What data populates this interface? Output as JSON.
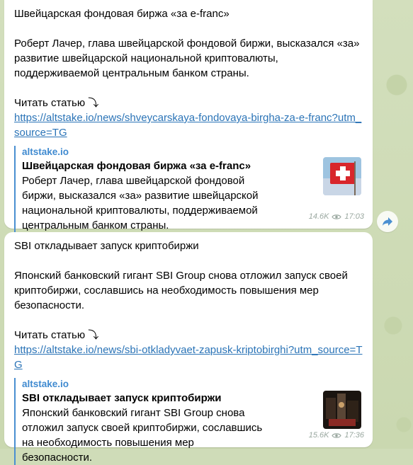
{
  "messages": [
    {
      "title": "Швейцарская фондовая биржа «за e-franc»",
      "body": "Роберт Лачер, глава швейцарской фондовой биржи, высказался «за» развитие швейцарской национальной криптовалюты, поддерживаемой центральным банком страны.",
      "read_label": "Читать статью ⤵",
      "link": "https://altstake.io/news/shveycarskaya-fondovaya-birgha-za-e-franc?utm_source=TG",
      "preview": {
        "site": "altstake.io",
        "title": "Швейцарская фондовая биржа «за e-franc»",
        "body": "Роберт Лачер, глава швейцарской фондовой биржи, высказался «за» развитие швейцарской национальной криптовалюты, поддерживаемой центральным банком страны."
      },
      "views": "14.6K",
      "time": "17:03"
    },
    {
      "title": "SBI откладывает запуск криптобиржи",
      "body": "Японский банковский гигант SBI Group снова отложил запуск своей криптобиржи, сославшись на необходимость повышения мер безопасности.",
      "read_label": "Читать статью ⤵",
      "link": "https://altstake.io/news/sbi-otkladyvaet-zapusk-kriptobirghi?utm_source=TG",
      "preview": {
        "site": "altstake.io",
        "title": "SBI откладывает запуск криптобиржи",
        "body": "Японский банковский гигант SBI Group снова отложил запуск своей криптобиржи, сославшись на необходимость повышения мер безопасности."
      },
      "views": "15.6K",
      "time": "17:36"
    }
  ],
  "icons": {
    "views": "eye-icon",
    "share": "share-arrow-icon"
  },
  "colors": {
    "link": "#2b74b7",
    "preview_bar": "#4a8fd1",
    "bubble": "#ffffff"
  }
}
